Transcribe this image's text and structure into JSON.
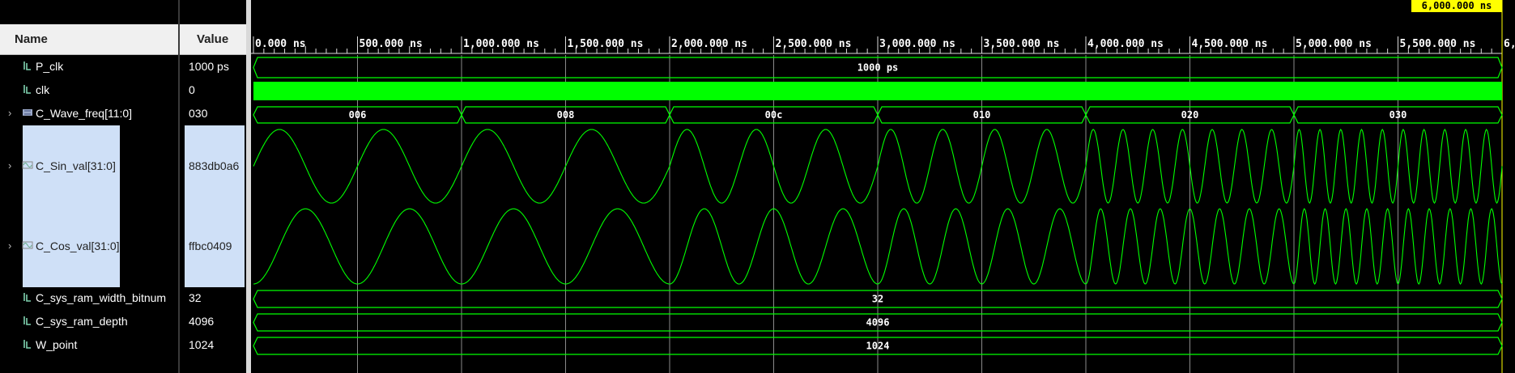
{
  "cursor": {
    "label": "6,000.000 ns"
  },
  "columns": {
    "name": "Name",
    "value": "Value"
  },
  "timeline": {
    "ticks": [
      "0.000 ns",
      "500.000 ns",
      "1,000.000 ns",
      "1,500.000 ns",
      "2,000.000 ns",
      "2,500.000 ns",
      "3,000.000 ns",
      "3,500.000 ns",
      "4,000.000 ns",
      "4,500.000 ns",
      "5,000.000 ns",
      "5,500.000 ns",
      "6,"
    ]
  },
  "signals": [
    {
      "id": "P_clk",
      "name": "P_clk",
      "value": "1000 ps",
      "kind": "bus",
      "expandable": false,
      "selected": false,
      "icon": "signal-icon",
      "segments": [
        {
          "label": "1000 ps"
        }
      ]
    },
    {
      "id": "clk",
      "name": "clk",
      "value": "0",
      "kind": "clock",
      "expandable": false,
      "selected": false,
      "icon": "signal-icon"
    },
    {
      "id": "C_Wave_freq",
      "name": "C_Wave_freq[11:0]",
      "value": "030",
      "kind": "bus",
      "expandable": true,
      "selected": false,
      "icon": "bus-icon",
      "segments": [
        {
          "label": "006"
        },
        {
          "label": "008"
        },
        {
          "label": "00c"
        },
        {
          "label": "010"
        },
        {
          "label": "020"
        },
        {
          "label": "030"
        }
      ]
    },
    {
      "id": "C_Sin_val",
      "name": "C_Sin_val[31:0]",
      "value": "883db0a6",
      "kind": "analog",
      "expandable": true,
      "selected": true,
      "icon": "analog-icon",
      "phase": "sin",
      "cycles_per_segment": [
        2,
        2,
        3,
        4,
        7,
        10
      ]
    },
    {
      "id": "C_Cos_val",
      "name": "C_Cos_val[31:0]",
      "value": "ffbc0409",
      "kind": "analog",
      "expandable": true,
      "selected": true,
      "icon": "analog-icon",
      "phase": "cos",
      "cycles_per_segment": [
        2,
        2,
        3,
        4,
        7,
        10
      ]
    },
    {
      "id": "C_sys_ram_width_bitnum",
      "name": "C_sys_ram_width_bitnum",
      "value": "32",
      "kind": "bus",
      "expandable": false,
      "selected": false,
      "icon": "signal-icon",
      "segments": [
        {
          "label": "32"
        }
      ]
    },
    {
      "id": "C_sys_ram_depth",
      "name": "C_sys_ram_depth",
      "value": "4096",
      "kind": "bus",
      "expandable": false,
      "selected": false,
      "icon": "signal-icon",
      "segments": [
        {
          "label": "4096"
        }
      ]
    },
    {
      "id": "W_point",
      "name": "W_point",
      "value": "1024",
      "kind": "bus",
      "expandable": false,
      "selected": false,
      "icon": "signal-icon",
      "segments": [
        {
          "label": "1024"
        }
      ]
    }
  ],
  "colors": {
    "wave": "#00ff00",
    "cursor_bg": "#ffff00",
    "selection": "#cfe0f7",
    "grid": "#8a8a8a"
  }
}
